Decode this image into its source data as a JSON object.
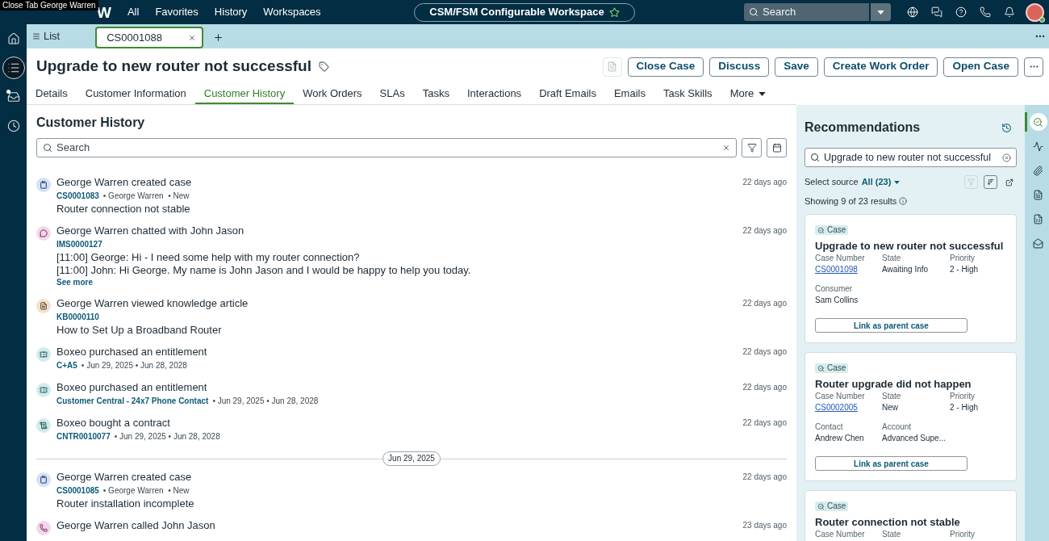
{
  "top_bar": {
    "tooltip": "Close Tab George Warren",
    "logo_text": "W",
    "menu": [
      "All",
      "Favorites",
      "History",
      "Workspaces"
    ],
    "workspace": "CSM/FSM Configurable Workspace",
    "search": {
      "placeholder": "Search"
    },
    "user": {
      "online": true
    }
  },
  "sidebar": {
    "items": [
      {
        "selected": false,
        "notification": false
      },
      {
        "selected": true,
        "notification": false
      },
      {
        "selected": false,
        "notification": true
      },
      {
        "selected": false,
        "notification": false
      }
    ]
  },
  "tab_bar": {
    "list_label": "List",
    "tabs": [
      {
        "label": "CS0001088",
        "selected": true
      }
    ]
  },
  "record": {
    "title": "Upgrade to new router not successful",
    "icon_action": {
      "disabled": true
    },
    "actions": [
      "Close Case",
      "Discuss",
      "Save",
      "Create Work Order",
      "Open Case"
    ],
    "tabs": [
      {
        "label": "Details",
        "selected": false
      },
      {
        "label": "Customer Information",
        "selected": false
      },
      {
        "label": "Customer History",
        "selected": true
      },
      {
        "label": "Work Orders",
        "selected": false
      },
      {
        "label": "SLAs",
        "selected": false
      },
      {
        "label": "Tasks",
        "selected": false
      },
      {
        "label": "Interactions",
        "selected": false
      },
      {
        "label": "Draft Emails",
        "selected": false
      },
      {
        "label": "Emails",
        "selected": false
      },
      {
        "label": "Task Skills",
        "selected": false
      }
    ],
    "more_label": "More"
  },
  "customer_history": {
    "title": "Customer History",
    "search": {
      "placeholder": "Search"
    },
    "entries": [
      {
        "kind": "case",
        "title": "George Warren created case",
        "link": "CS0001083",
        "meta": "• George Warren  • New",
        "body": [
          "Router connection not stable"
        ],
        "time": "22 days ago"
      },
      {
        "kind": "chat",
        "title": "George Warren chatted with John Jason",
        "link": "IMS0000127",
        "body": [
          "[11:00] George: Hi - I need some help with my router connection?",
          "[11:00] John: Hi George. My name is John Jason and I would be happy to help you today."
        ],
        "see_more": "See more",
        "time": "22 days ago"
      },
      {
        "kind": "article",
        "title": "George Warren viewed knowledge article",
        "link": "KB0000110",
        "body": [
          "How to Set Up a Broadband Router"
        ],
        "time": "22 days ago"
      },
      {
        "kind": "entitlement",
        "title": "Boxeo purchased an entitlement",
        "link": "C+A5",
        "meta": "• Jun 29, 2025 • Jun 28, 2028",
        "time": "22 days ago"
      },
      {
        "kind": "entitlement",
        "title": "Boxeo purchased an entitlement",
        "link": "Customer Central - 24x7 Phone Contact",
        "meta": "• Jun 29, 2025 • Jun 28, 2028",
        "time": "22 days ago"
      },
      {
        "kind": "contract",
        "title": "Boxeo bought a contract",
        "link": "CNTR0010077",
        "meta": "• Jun 29, 2025 • Jun 28, 2028",
        "time": "22 days ago"
      },
      {
        "kind": "date",
        "label": "Jun 29, 2025"
      },
      {
        "kind": "case",
        "title": "George Warren created case",
        "link": "CS0001085",
        "meta": "• George Warren  • New",
        "body": [
          "Router installation incomplete"
        ],
        "time": "22 days ago"
      },
      {
        "kind": "call",
        "title": "George Warren called John Jason",
        "time": "23 days ago"
      }
    ]
  },
  "recommendations": {
    "title": "Recommendations",
    "search": {
      "value": "Upgrade to new router not successful"
    },
    "source_label": "Select source",
    "source_value": "All (23)",
    "filter_disabled": true,
    "results_text": "Showing 9 of 23 results",
    "cards": [
      {
        "tag": "Case",
        "title": "Upgrade to new router not successful",
        "rows": [
          [
            {
              "label": "Case Number",
              "value": "CS0001098",
              "kind": "link"
            },
            {
              "label": "State",
              "value": "Awaiting Info",
              "kind": "text"
            },
            {
              "label": "Priority",
              "value": "2 - High",
              "kind": "text"
            }
          ],
          [
            {
              "label": "Consumer",
              "value": "Sam Collins",
              "kind": "text"
            }
          ]
        ],
        "button": "Link as parent case"
      },
      {
        "tag": "Case",
        "title": "Router upgrade did not happen",
        "rows": [
          [
            {
              "label": "Case Number",
              "value": "CS0002005",
              "kind": "link"
            },
            {
              "label": "State",
              "value": "New",
              "kind": "text"
            },
            {
              "label": "Priority",
              "value": "2 - High",
              "kind": "text"
            }
          ],
          [
            {
              "label": "Contact",
              "value": "Andrew Chen",
              "kind": "text"
            },
            {
              "label": "Account",
              "value": "Advanced Supe...",
              "kind": "text"
            }
          ]
        ],
        "button": "Link as parent case"
      },
      {
        "tag": "Case",
        "title": "Router connection not stable",
        "rows": [
          [
            {
              "label": "Case Number"
            },
            {
              "label": "State"
            },
            {
              "label": "Priority"
            }
          ]
        ]
      }
    ]
  },
  "right_rail": {
    "items": [
      {
        "selected": true
      },
      {
        "selected": false
      },
      {
        "selected": false
      },
      {
        "selected": false
      },
      {
        "selected": false
      },
      {
        "selected": false
      }
    ]
  }
}
